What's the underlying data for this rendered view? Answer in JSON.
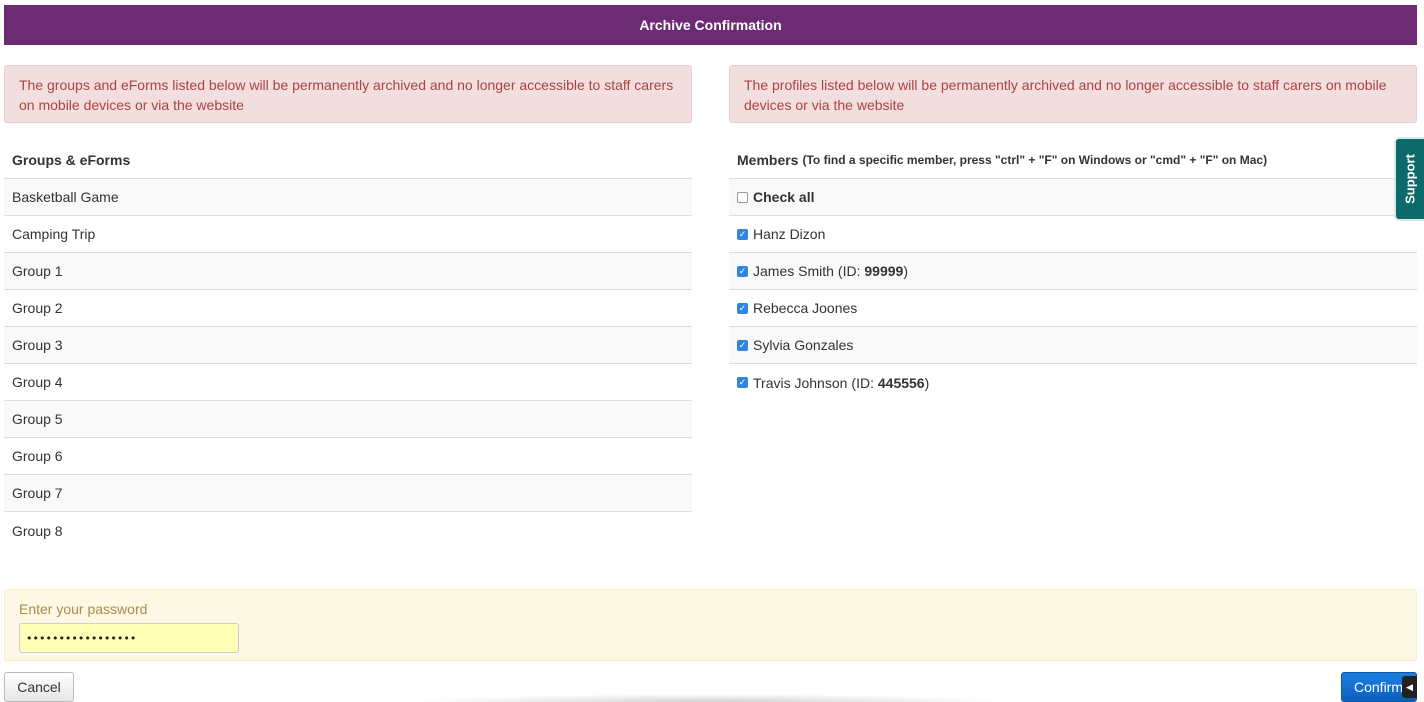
{
  "dialog": {
    "title": "Archive Confirmation"
  },
  "left_alert": "The groups and eForms listed below will be permanently archived and no longer accessible to staff carers on mobile devices or via the website",
  "right_alert": "The profiles listed below will be permanently archived and no longer accessible to staff carers on mobile devices or via the website",
  "groups": {
    "header": "Groups & eForms",
    "items": [
      "Basketball Game",
      "Camping Trip",
      "Group 1",
      "Group 2",
      "Group 3",
      "Group 4",
      "Group 5",
      "Group 6",
      "Group 7",
      "Group 8"
    ]
  },
  "members": {
    "header": "Members",
    "hint": "(To find a specific member, press \"ctrl\" + \"F\" on Windows or \"cmd\" + \"F\" on Mac)",
    "check_all_label": "Check all",
    "check_all_checked": false,
    "id_prefix": "(ID: ",
    "id_suffix": ")",
    "items": [
      {
        "name": "Hanz Dizon",
        "id": "",
        "checked": true
      },
      {
        "name": "James Smith",
        "id": "99999",
        "checked": true
      },
      {
        "name": "Rebecca Joones",
        "id": "",
        "checked": true
      },
      {
        "name": "Sylvia Gonzales",
        "id": "",
        "checked": true
      },
      {
        "name": "Travis Johnson",
        "id": "445556",
        "checked": true
      }
    ]
  },
  "password": {
    "label": "Enter your password",
    "masked_value": "•••••••••••••••••"
  },
  "buttons": {
    "cancel": "Cancel",
    "confirm": "Confirm"
  },
  "support_tab": {
    "label": "Support"
  },
  "colors": {
    "title_bar": "#6d2b73",
    "danger_bg": "#f2dede",
    "danger_text": "#a94442",
    "warning_bg": "#fcf8e3",
    "primary": "#1a7fe0",
    "support": "#0c6a6a"
  }
}
